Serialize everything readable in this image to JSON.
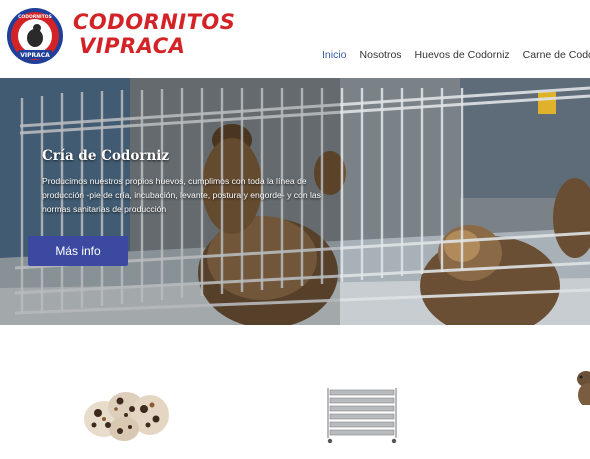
{
  "header": {
    "logo_alt": "Codornitos Vipraca badge",
    "badge_text_top": "CODORNITOS",
    "badge_text_bottom": "VIPRACA",
    "brand_line1": "CODORNITOS",
    "brand_line2": "VIPRACA"
  },
  "nav": {
    "items": [
      {
        "label": "Inicio",
        "active": true
      },
      {
        "label": "Nosotros",
        "active": false
      },
      {
        "label": "Huevos de Codorniz",
        "active": false
      },
      {
        "label": "Carne de Codorniz",
        "active": false
      }
    ]
  },
  "hero": {
    "title": "Cría de Codorniz",
    "text": "Producimos nuestros propios huevos, cumplimos con toda la línea de producción -pie de cría, incubación, levante, postura y engorde- y con las normas sanitarias de producción",
    "button_label": "Más info"
  },
  "colors": {
    "brand_red": "#d42327",
    "nav_active": "#3b5ba8",
    "button_blue": "#3b4aa0"
  },
  "products": [
    {
      "icon": "quail-eggs-image"
    },
    {
      "icon": "incubator-rack-image"
    },
    {
      "icon": "quail-bird-image"
    }
  ]
}
